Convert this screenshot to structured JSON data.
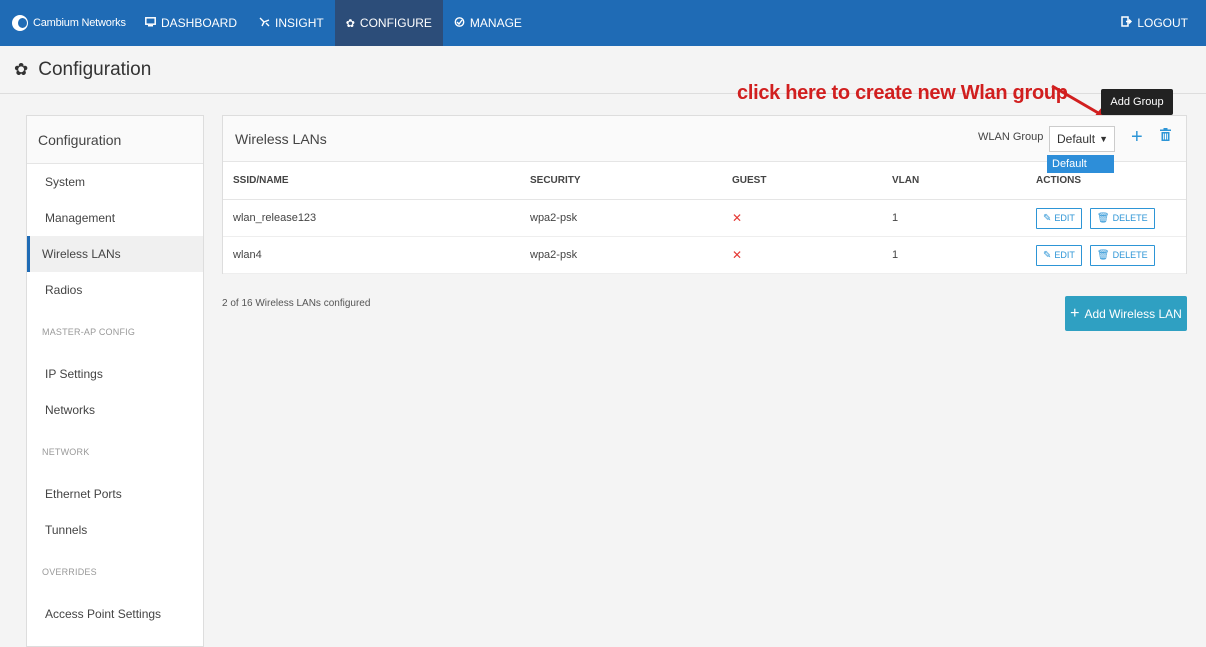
{
  "nav": {
    "brand": "Cambium Networks",
    "items": [
      {
        "label": "DASHBOARD",
        "icon": "monitor-icon"
      },
      {
        "label": "INSIGHT",
        "icon": "insight-icon"
      },
      {
        "label": "CONFIGURE",
        "icon": "gear-icon"
      },
      {
        "label": "MANAGE",
        "icon": "manage-icon"
      }
    ],
    "logout": "LOGOUT"
  },
  "page": {
    "title": "Configuration"
  },
  "annotation": "click here to create new Wlan group",
  "tooltip": "Add Group",
  "sidebar": {
    "heading": "Configuration",
    "items": [
      "System",
      "Management",
      "Wireless LANs",
      "Radios"
    ],
    "section1": "MASTER-AP CONFIG",
    "items2": [
      "IP Settings",
      "Networks"
    ],
    "section2": "NETWORK",
    "items3": [
      "Ethernet Ports",
      "Tunnels"
    ],
    "section3": "OVERRIDES",
    "items4": [
      "Access Point Settings"
    ]
  },
  "panel": {
    "title": "Wireless LANs",
    "wlan_group_label": "WLAN Group",
    "wlan_group_value": "Default",
    "dropdown_option": "Default",
    "columns": [
      "SSID/NAME",
      "SECURITY",
      "GUEST",
      "VLAN",
      "ACTIONS"
    ],
    "rows": [
      {
        "ssid": "wlan_release123",
        "security": "wpa2-psk",
        "guest": "✕",
        "vlan": "1"
      },
      {
        "ssid": "wlan4",
        "security": "wpa2-psk",
        "guest": "✕",
        "vlan": "1"
      }
    ],
    "edit_label": "EDIT",
    "delete_label": "DELETE"
  },
  "footer": {
    "count_text": "2 of 16 Wireless LANs configured",
    "add_button": "Add Wireless LAN"
  },
  "colors": {
    "nav_bg": "#1f6bb5",
    "accent": "#2d95d6",
    "annotation": "#d11f1f",
    "add_button": "#2fa0c2"
  }
}
